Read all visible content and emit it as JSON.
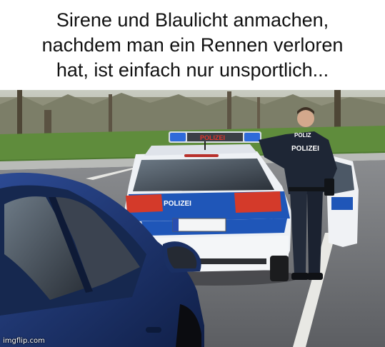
{
  "meme": {
    "caption_lines": [
      "Sirene und Blaulicht anmachen,",
      "nachdem man ein Rennen verloren",
      "hat, ist einfach nur unsportlich..."
    ],
    "car_door_text": "POLIZEI",
    "lightbar_text": "POLIZEI",
    "officer_back_text": "POLIZEI",
    "officer_shoulder_text": "POLIZ",
    "watermark": "imgflip.com"
  },
  "colors": {
    "police_blue": "#1f56b8",
    "car_white": "#eef1f5",
    "blue_car": "#1d3570",
    "grass": "#5f8c3c",
    "asphalt": "#6f7175",
    "uniform": "#1e2635"
  }
}
